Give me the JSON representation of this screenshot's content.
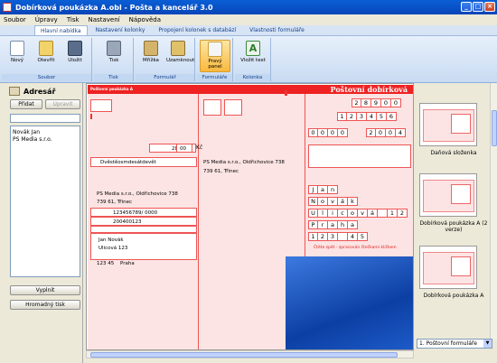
{
  "window": {
    "title": "Dobírková poukázka A.obl - Pošta a kancelář 3.0"
  },
  "menu": [
    "Soubor",
    "Úpravy",
    "Tisk",
    "Nastavení",
    "Nápověda"
  ],
  "tabs": [
    "Hlavní nabídka",
    "Nastavení kolonky",
    "Propojení kolonek s databází",
    "Vlastnosti formuláře"
  ],
  "ribbon": {
    "groups": [
      "Soubor",
      "Tisk",
      "Formulář",
      "Formuláře",
      "Kolonka"
    ],
    "buttons": [
      "Nový",
      "Otevřít",
      "Uložit",
      "Tisk",
      "Mřížka",
      "Uzamknout",
      "Pravý panel",
      "Vložit text"
    ]
  },
  "left": {
    "title": "Adresář",
    "add": "Přidat",
    "edit": "Upravit",
    "contacts": [
      "Novák Jan",
      "PS Media s.r.o."
    ],
    "fill": "Vyplnit",
    "bulk_print": "Hromadný tisk"
  },
  "form": {
    "header": "Poštovní dobírková",
    "sender_hdr": "Poštovní poukázka A",
    "amount": "289",
    "amount_cents": "00",
    "amount_words": "Dvěstěosmdesátdevět",
    "payee_name": "PS Media s.r.o., Oldřichovice 738",
    "payee_city": "739 61, Třinec",
    "account": "123456789/ 0000",
    "vs": "200400123",
    "sender_name": "Jan      Novák",
    "sender_street": "Ulicová 123",
    "sender_zip": "123 45",
    "sender_city": "Praha",
    "code_row1": [
      "2",
      "8",
      "9",
      "0",
      "0"
    ],
    "code_row2": [
      "1",
      "2",
      "3",
      "4",
      "5",
      "6"
    ],
    "code_row3": [
      "0",
      "0",
      "0",
      "0"
    ],
    "code_row4": [
      "2",
      "0",
      "0",
      "4"
    ],
    "grid_name": [
      "J",
      "a",
      "n"
    ],
    "grid_surname": [
      "N",
      "o",
      "v",
      "á",
      "k"
    ],
    "grid_street": [
      "U",
      "l",
      "i",
      "c",
      "o",
      "v",
      "á",
      " ",
      "1",
      "2",
      "3"
    ],
    "grid_city": [
      "P",
      "r",
      "a",
      "h",
      "a"
    ],
    "grid_zip": [
      "1",
      "2",
      "3",
      " ",
      "4",
      "5"
    ],
    "footer_note": "Čtěte zpět - zpracován čtečkami klíčkem"
  },
  "right": {
    "thumbs": [
      "Daňová složenka",
      "Dobírková poukázka A (2 verze)",
      "Dobírková poukázka A"
    ],
    "selector": "1. Poštovní formuláře"
  }
}
